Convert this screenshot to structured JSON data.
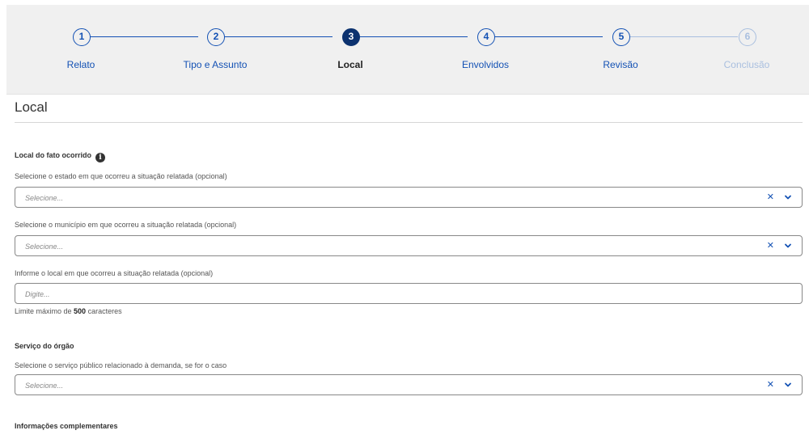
{
  "stepper": {
    "steps": [
      {
        "number": "1",
        "label": "Relato"
      },
      {
        "number": "2",
        "label": "Tipo e Assunto"
      },
      {
        "number": "3",
        "label": "Local"
      },
      {
        "number": "4",
        "label": "Envolvidos"
      },
      {
        "number": "5",
        "label": "Revisão"
      },
      {
        "number": "6",
        "label": "Conclusão"
      }
    ],
    "active_step": 3
  },
  "page": {
    "title": "Local"
  },
  "local_group": {
    "title": "Local do fato ocorrido",
    "info_icon": "i",
    "estado": {
      "label": "Selecione o estado em que ocorreu a situação relatada (opcional)",
      "placeholder": "Selecione..."
    },
    "municipio": {
      "label": "Selecione o município em que ocorreu a situação relatada (opcional)",
      "placeholder": "Selecione..."
    },
    "local": {
      "label": "Informe o local em que ocorreu a situação relatada (opcional)",
      "placeholder": "Digite...",
      "hint_prefix": "Limite máximo de ",
      "hint_number": "500",
      "hint_suffix": " caracteres"
    }
  },
  "servico_group": {
    "title": "Serviço do órgão",
    "servico": {
      "label": "Selecione o serviço público relacionado à demanda, se for o caso",
      "placeholder": "Selecione..."
    }
  },
  "complementares_group": {
    "title": "Informações complementares"
  },
  "icons": {
    "clear": "✕",
    "clear_icon_name": "close-icon",
    "dropdown_icon_name": "chevron-down-icon"
  },
  "colors": {
    "primary": "#1351b4",
    "active": "#0c326f",
    "disabled": "#a9bfdf",
    "stepper_bg": "#f0f0f0"
  }
}
